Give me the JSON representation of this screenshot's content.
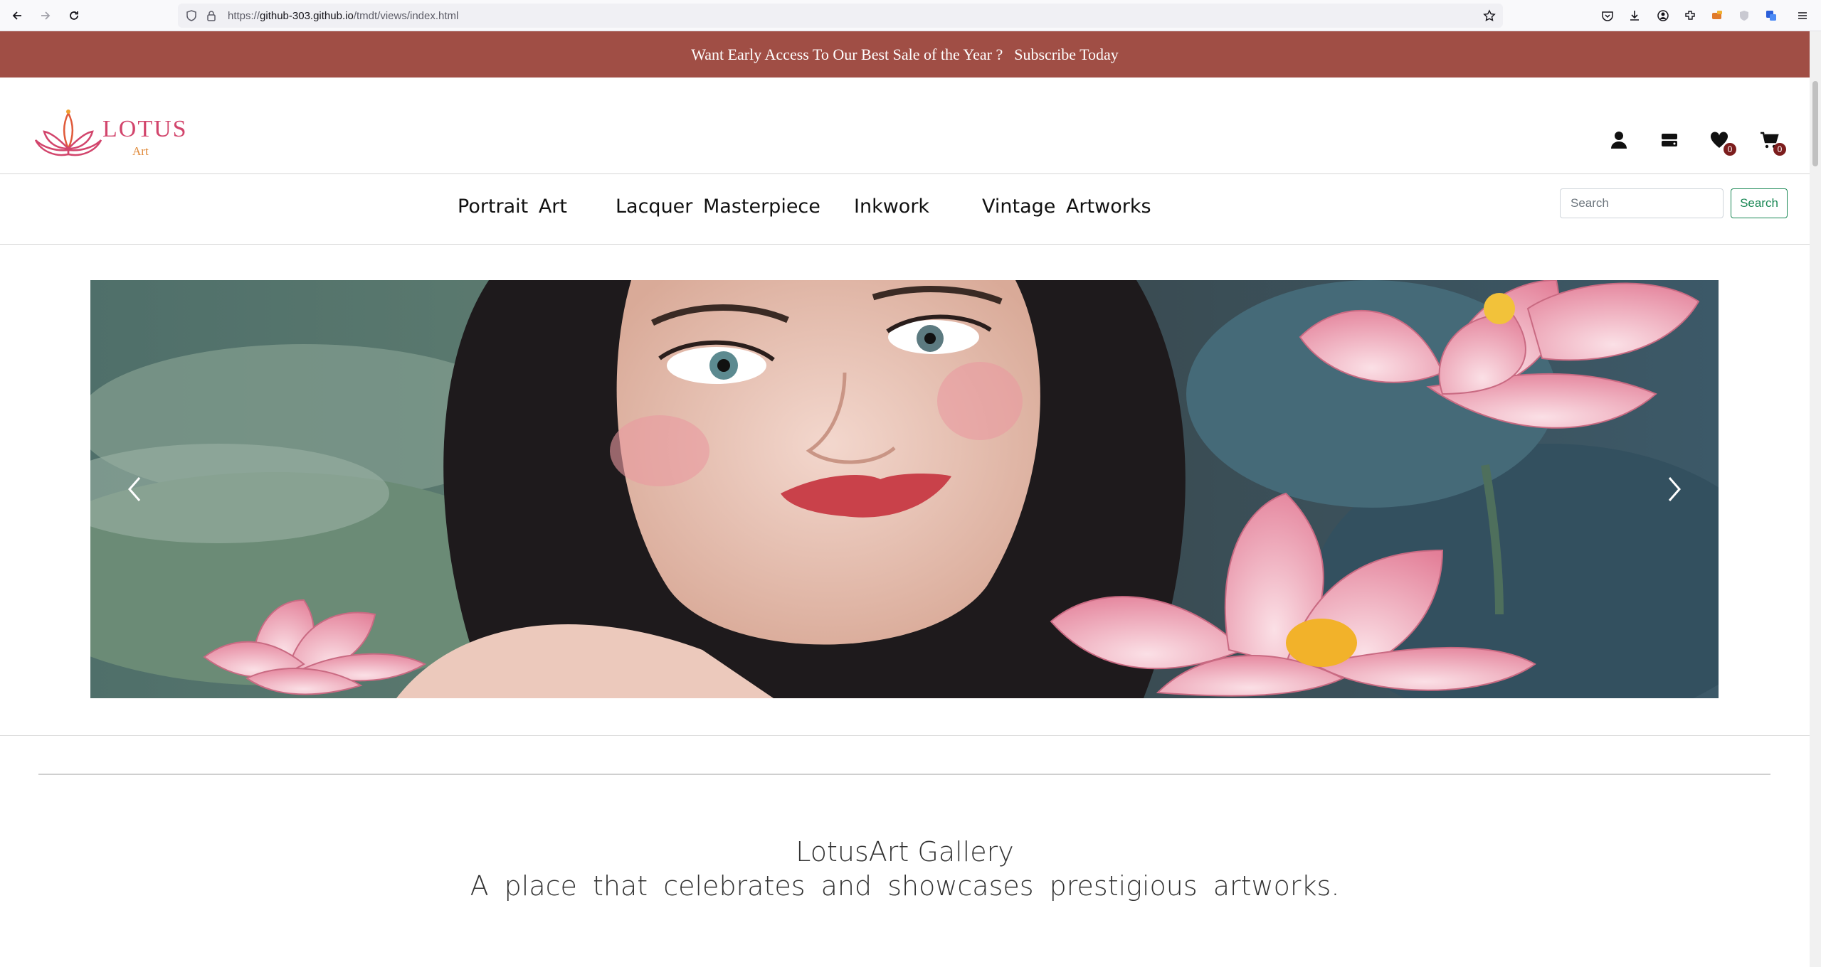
{
  "browser": {
    "url_prefix": "https://",
    "url_host": "github-303.github.io",
    "url_path": "/tmdt/views/index.html",
    "toolbar_icons": [
      "pocket-icon",
      "download-icon",
      "account-icon",
      "extensions-icon",
      "addon-icon",
      "translate-icon",
      "menu-icon"
    ]
  },
  "promo": {
    "text": "Want Early Access To Our Best Sale of the Year ?",
    "link": "Subscribe Today",
    "background": "#a04e45"
  },
  "logo": {
    "word": "LOTUS",
    "sub": "Art"
  },
  "header_icons": {
    "wishlist_count": "0",
    "cart_count": "0"
  },
  "nav": {
    "items": [
      "Portrait Art",
      "Lacquer Masterpiece",
      "Inkwork",
      "Vintage Artworks"
    ]
  },
  "search": {
    "placeholder": "Search",
    "button": "Search",
    "button_color": "#198754"
  },
  "hero": {
    "prev": "previous-slide",
    "next": "next-slide"
  },
  "intro": {
    "title": "LotusArt Gallery",
    "subtitle": "A place that celebrates and showcases prestigious artworks."
  }
}
